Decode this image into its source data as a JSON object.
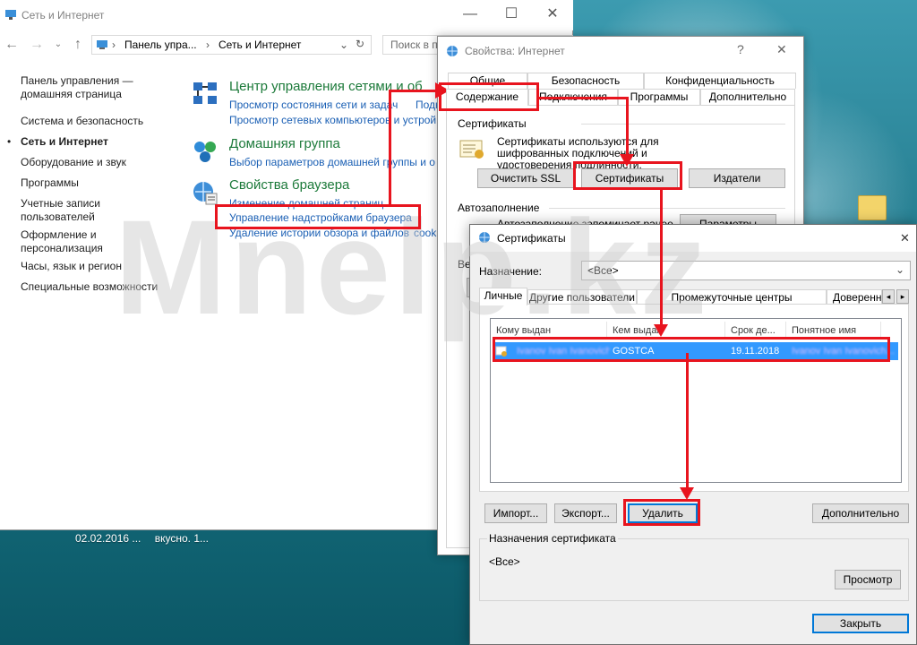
{
  "desktop": {
    "caption_date": "02.02.2016 ...",
    "caption_name": "вкусно. 1..."
  },
  "watermark": "Mnelp.kz",
  "control_panel": {
    "title": "Сеть и Интернет",
    "minimize": "—",
    "maximize": "☐",
    "close": "✕",
    "breadcrumb": [
      "Панель упра...",
      "Сеть и Интернет"
    ],
    "search_placeholder": "Поиск в п",
    "left_nav": [
      {
        "label": "Панель управления —\nдомашняя страница",
        "active": false
      },
      {
        "label": "Система и безопасность",
        "active": false
      },
      {
        "label": "Сеть и Интернет",
        "active": true
      },
      {
        "label": "Оборудование и звук",
        "active": false
      },
      {
        "label": "Программы",
        "active": false
      },
      {
        "label": "Учетные записи\nпользователей",
        "active": false
      },
      {
        "label": "Оформление и\nперсонализация",
        "active": false
      },
      {
        "label": "Часы, язык и регион",
        "active": false
      },
      {
        "label": "Специальные возможности",
        "active": false
      }
    ],
    "sections": [
      {
        "heading": "Центр управления сетями и об",
        "links": [
          "Просмотр состояния сети и задач",
          "Подк",
          "Просмотр сетевых компьютеров и устрой"
        ]
      },
      {
        "heading": "Домашняя группа",
        "links": [
          "Выбор параметров домашней группы и о"
        ]
      },
      {
        "heading": "Свойства браузера",
        "links": [
          "Изменение домашней страниц",
          "Управление надстройками браузера",
          "Удаление истории обзора и файлов",
          "cooki"
        ]
      }
    ]
  },
  "inet_dialog": {
    "title": "Свойства: Интернет",
    "help": "?",
    "close": "✕",
    "tabs_row1": [
      "Общие",
      "Безопасность",
      "Конфиденциальность"
    ],
    "tabs_row2": [
      "Содержание",
      "Подключения",
      "Программы",
      "Дополнительно"
    ],
    "certificates_group": "Сертификаты",
    "certificates_desc": "Сертификаты используются для шифрованных подключений и удостоверения подлинности.",
    "buttons": {
      "clear_ssl": "Очистить SSL",
      "certificates": "Сертификаты",
      "publishers": "Издатели"
    },
    "autocomplete_group": "Автозаполнение",
    "autocomplete_desc": "Автозаполнение запоминает ранее",
    "autocomplete_params": "Параметры",
    "feeds_label": "Ве"
  },
  "cert_dialog": {
    "title": "Сертификаты",
    "close": "✕",
    "purpose_label": "Назначение:",
    "purpose_value": "<Все>",
    "tabs": [
      "Личные",
      "Другие пользователи",
      "Промежуточные центры сертификации",
      "Доверенн"
    ],
    "columns": [
      "Кому выдан",
      "Кем выдан",
      "Срок де...",
      "Понятное имя"
    ],
    "rows": [
      {
        "issued_to": "Ivanov Ivan Ivanovich",
        "issued_by": "GOSTCA",
        "expires": "19.11.2018",
        "friendly_name": "Ivanov Ivan Ivanovich..."
      }
    ],
    "buttons": {
      "import": "Импорт...",
      "export": "Экспорт...",
      "delete": "Удалить",
      "advanced": "Дополнительно",
      "view": "Просмотр",
      "close": "Закрыть"
    },
    "purposes_group": "Назначения сертификата",
    "purposes_value": "<Все>"
  },
  "colors": {
    "annotation_red": "#e8141e",
    "link_blue": "#1a5fb4",
    "heading_green": "#1c7a3a",
    "selection_blue": "#3399ff"
  }
}
